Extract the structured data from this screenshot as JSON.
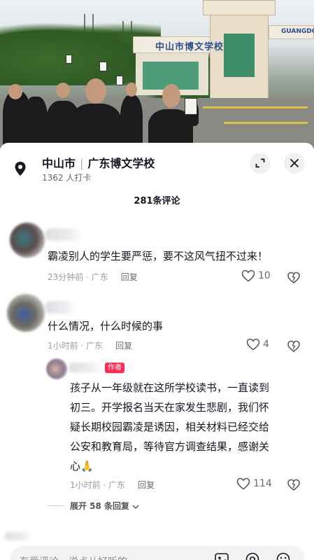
{
  "video": {
    "sign_cn": "中山市博文学校",
    "sign_en": "GUANGDONG"
  },
  "location": {
    "city": "中山市",
    "separator": "|",
    "place": "广东博文学校",
    "checkins": "1362 人打卡"
  },
  "comments_header": "281条评论",
  "comments": [
    {
      "text": "霸凌别人的学生要严惩，要不这风气扭不过来！",
      "time_location": "23分钟前 · 广东",
      "reply_label": "回复",
      "likes": "10"
    },
    {
      "text": "什么情况，什么时候的事",
      "time_location": "1小时前 · 广东",
      "reply_label": "回复",
      "likes": "4"
    }
  ],
  "author_reply": {
    "badge": "作者",
    "lines": [
      "孩子从一年级就在这所学校读书，一直读到",
      "初三。开学报名当天在家发生悲剧，我们怀",
      "疑长期校园霸凌是诱因，相关材料已经交给",
      "公安和教育局，等待官方调查结果，感谢关",
      "心🙏"
    ],
    "time_location": "1小时前 · 广东",
    "reply_label": "回复",
    "likes": "114"
  },
  "expand_replies": "展开 58 条回复",
  "input": {
    "placeholder": "有爱评论，说点儿好听的"
  },
  "colors": {
    "author_badge": "#fe2c55",
    "text_primary": "#161823",
    "text_secondary": "#9b9ca2"
  }
}
